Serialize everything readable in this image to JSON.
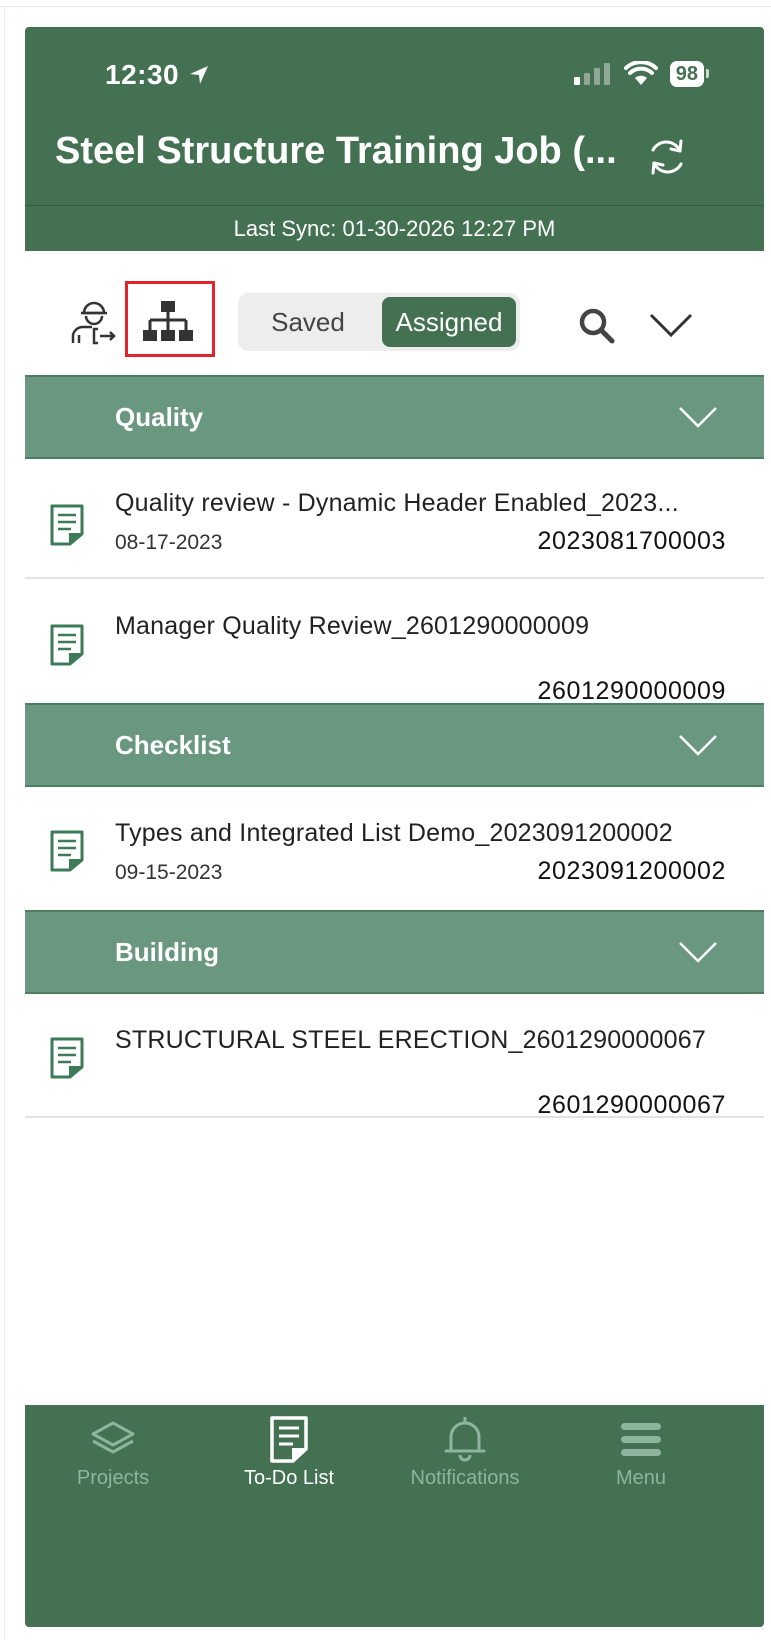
{
  "status_bar": {
    "time": "12:30",
    "battery": "98"
  },
  "header": {
    "title": "Steel Structure Training Job (...",
    "last_sync": "Last Sync: 01-30-2026 12:27 PM"
  },
  "toolbar": {
    "saved_label": "Saved",
    "assigned_label": "Assigned",
    "selected_segment": "Assigned"
  },
  "sections": [
    {
      "title": "Quality",
      "items": [
        {
          "title": "Quality review - Dynamic Header Enabled_2023...",
          "date": "08-17-2023",
          "id": "2023081700003"
        },
        {
          "title": "Manager Quality Review_2601290000009",
          "date": "",
          "id": "2601290000009"
        }
      ]
    },
    {
      "title": "Checklist",
      "items": [
        {
          "title": "Types and Integrated List Demo_2023091200002",
          "date": "09-15-2023",
          "id": "2023091200002"
        }
      ]
    },
    {
      "title": "Building",
      "items": [
        {
          "title": "STRUCTURAL STEEL ERECTION_2601290000067",
          "date": "",
          "id": "2601290000067"
        }
      ]
    }
  ],
  "tabbar": {
    "tabs": [
      {
        "label": "Projects",
        "icon": "layers-icon"
      },
      {
        "label": "To-Do List",
        "icon": "document-icon",
        "active": true
      },
      {
        "label": "Notifications",
        "icon": "bell-icon"
      },
      {
        "label": "Menu",
        "icon": "hamburger-menu-icon"
      }
    ]
  },
  "colors": {
    "primary": "#437152",
    "section_header": "#69977f",
    "highlight_box": "#e0242a"
  }
}
